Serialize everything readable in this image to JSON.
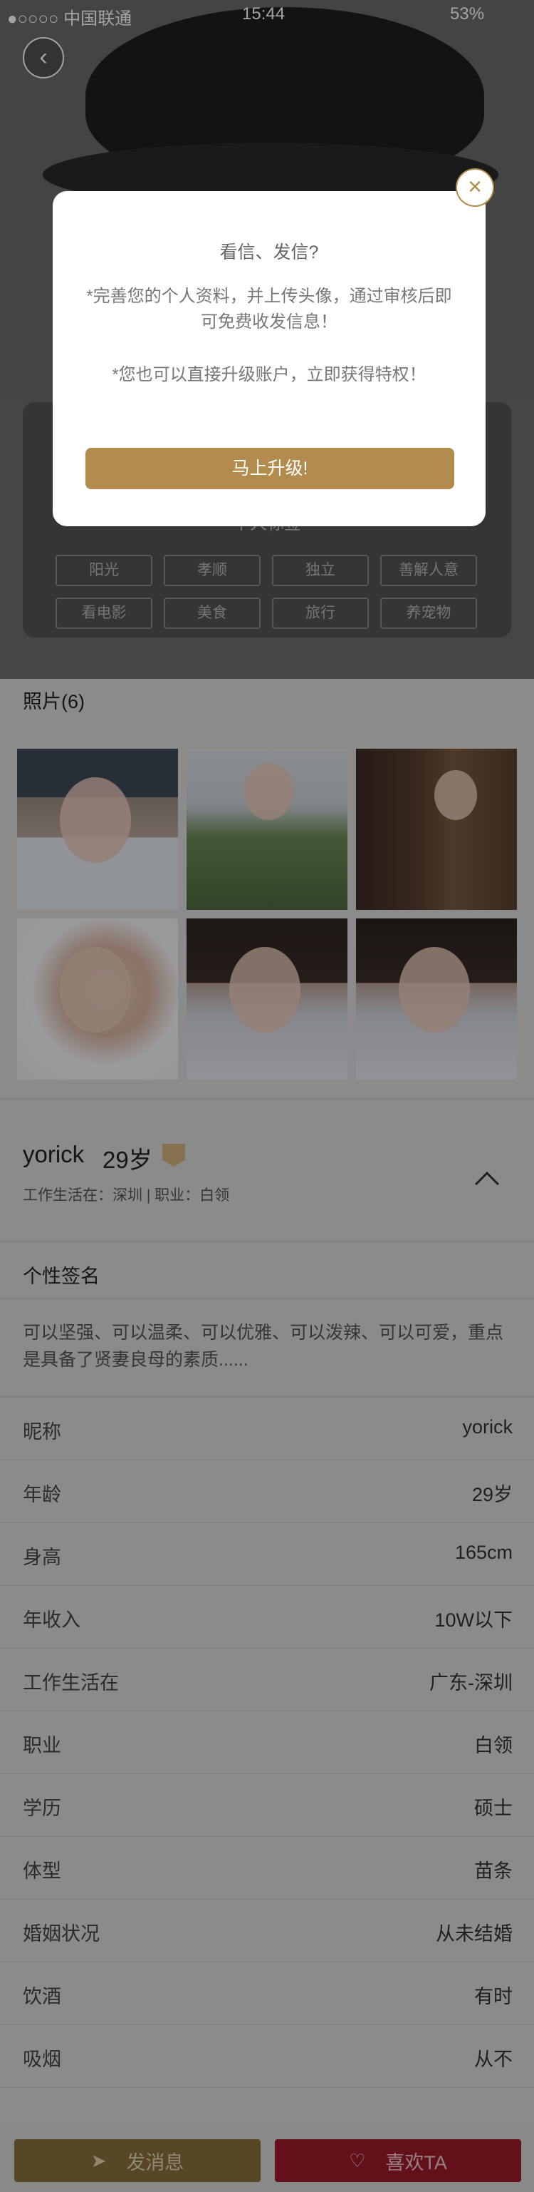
{
  "status_bar": {
    "carrier": "●○○○○ 中国联通",
    "time": "15:44",
    "battery": "53%"
  },
  "header": {
    "back_icon": "chevron-left-icon",
    "tag_title": "个人标签",
    "tags": [
      "阳光",
      "孝顺",
      "独立",
      "善解人意",
      "看电影",
      "美食",
      "旅行",
      "养宠物"
    ]
  },
  "photos": {
    "title": "照片(6)"
  },
  "profile": {
    "name": "yorick",
    "age": "29岁",
    "badge": "VIP",
    "sub_info": "工作生活在：深圳 | 职业：白领",
    "signature_title": "个性签名",
    "signature_text": "可以坚强、可以温柔、可以优雅、可以泼辣、可以可爱，重点是具备了贤妻良母的素质......"
  },
  "details": [
    {
      "label": "昵称",
      "value": "yorick"
    },
    {
      "label": "年龄",
      "value": "29岁"
    },
    {
      "label": "身高",
      "value": "165cm"
    },
    {
      "label": "年收入",
      "value": "10W以下"
    },
    {
      "label": "工作生活在",
      "value": "广东-深圳"
    },
    {
      "label": "职业",
      "value": "白领"
    },
    {
      "label": "学历",
      "value": "硕士"
    },
    {
      "label": "体型",
      "value": "苗条"
    },
    {
      "label": "婚姻状况",
      "value": "从未结婚"
    },
    {
      "label": "饮酒",
      "value": "有时"
    },
    {
      "label": "吸烟",
      "value": "从不"
    }
  ],
  "bottom": {
    "message_label": "发消息",
    "like_label": "喜欢TA"
  },
  "modal": {
    "title": "看信、发信?",
    "line1": "*完善您的个人资料，并上传头像，通过审核后即可免费收发信息！",
    "line2": "*您也可以直接升级账户，立即获得特权！",
    "button": "马上升级!",
    "close_icon": "close-icon"
  },
  "colors": {
    "gold": "#b28b4d",
    "like_red": "#9b1a2a"
  }
}
